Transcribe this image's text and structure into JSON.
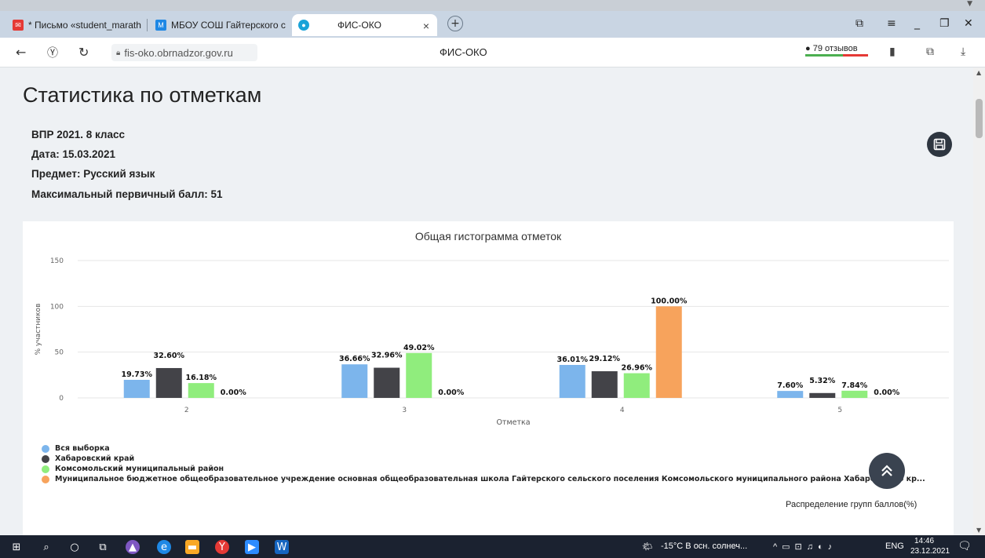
{
  "browser": {
    "tabs": [
      {
        "label": "* Письмо «student_marath",
        "icon": "mail-icon"
      },
      {
        "label": "МБОУ СОШ Гайтерского с",
        "icon": "site-icon"
      },
      {
        "label": "ФИС-ОКО",
        "icon": "fis-icon"
      }
    ],
    "url": "fis-oko.obrnadzor.gov.ru",
    "page_title": "ФИС-ОКО",
    "reviews": "79 отзывов"
  },
  "page": {
    "heading": "Статистика по отметкам",
    "meta": [
      "ВПР 2021. 8 класс",
      "Дата: 15.03.2021",
      "Предмет: Русский язык",
      "Максимальный первичный балл: 51"
    ],
    "distribution_label": "Распределение групп баллов(%)"
  },
  "chart_data": {
    "type": "bar",
    "title": "Общая гистограмма отметок",
    "xlabel": "Отметка",
    "ylabel": "% участников",
    "ylim": [
      0,
      150
    ],
    "yticks": [
      0,
      50,
      100,
      150
    ],
    "categories": [
      "2",
      "3",
      "4",
      "5"
    ],
    "legend_position": "bottom-left",
    "series": [
      {
        "name": "Вся выборка",
        "color": "#7cb5ec",
        "values": [
          19.73,
          36.66,
          36.01,
          7.6
        ]
      },
      {
        "name": "Хабаровский край",
        "color": "#434348",
        "values": [
          32.6,
          32.96,
          29.12,
          5.32
        ]
      },
      {
        "name": "Комсомольский муниципальный район",
        "color": "#90ed7d",
        "values": [
          16.18,
          49.02,
          26.96,
          7.84
        ]
      },
      {
        "name": "Муниципальное бюджетное общеобразовательное учреждение основная общеобразовательная школа Гайтерского сельского поселения Комсомольского муниципального района Хабаровского кр...",
        "color": "#f7a35c",
        "values": [
          0.0,
          0.0,
          100.0,
          0.0
        ]
      }
    ]
  },
  "taskbar": {
    "weather": "-15°C  В осн. солнеч...",
    "lang": "ENG",
    "time": "14:46",
    "date": "23.12.2021"
  }
}
